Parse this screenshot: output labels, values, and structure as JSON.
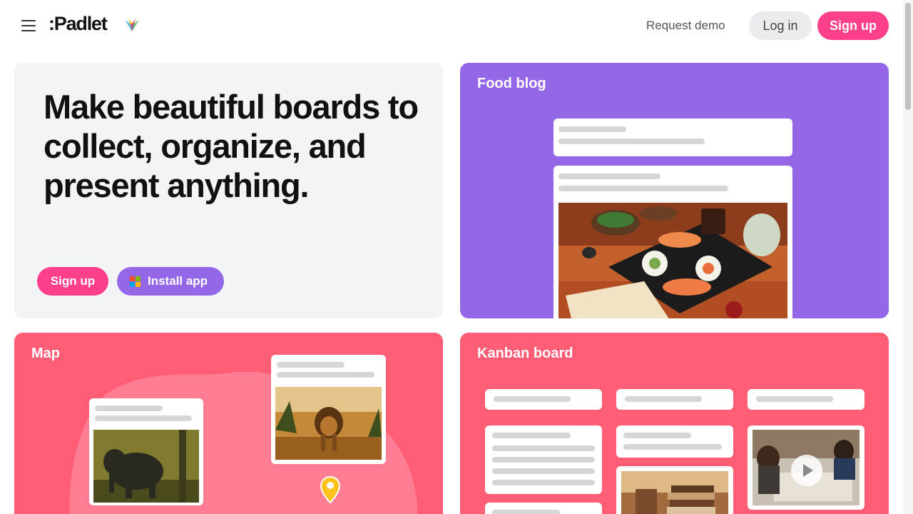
{
  "header": {
    "logo_text": ":Padlet",
    "request_demo": "Request demo",
    "login": "Log in",
    "signup": "Sign up"
  },
  "hero": {
    "headline": "Make beautiful boards to collect, organize, and present anything.",
    "signup": "Sign up",
    "install_app": "Install app"
  },
  "cards": {
    "food_blog": {
      "title": "Food blog"
    },
    "map": {
      "title": "Map"
    },
    "kanban": {
      "title": "Kanban board"
    }
  },
  "colors": {
    "brand_pink": "#fe3f8a",
    "brand_purple": "#9467e8",
    "card_coral": "#ff5d75",
    "hero_bg": "#f3f4f6"
  },
  "icons": [
    "hamburger-menu-icon",
    "padlet-logo-mark-icon",
    "windows-logo-icon",
    "map-pin-icon",
    "play-icon"
  ]
}
